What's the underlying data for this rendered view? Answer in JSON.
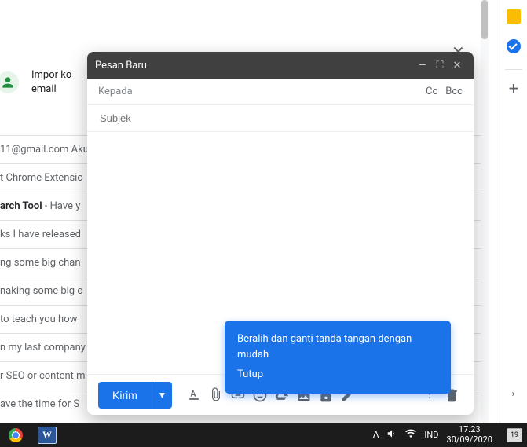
{
  "promo_line1": "Impor ko",
  "promo_line2": "email",
  "rows": [
    {
      "prefix": "",
      "bold": "",
      "suffix": "11@gmail.com Aku"
    },
    {
      "prefix": "",
      "bold": "",
      "suffix": "t Chrome Extensio"
    },
    {
      "prefix": "",
      "bold": "arch Tool",
      "suffix": " - Have y"
    },
    {
      "prefix": "",
      "bold": "",
      "suffix": "ks I have released"
    },
    {
      "prefix": "",
      "bold": "",
      "suffix": "ng some big chan"
    },
    {
      "prefix": "",
      "bold": "",
      "suffix": "naking some big c"
    },
    {
      "prefix": "",
      "bold": "",
      "suffix": " to teach you how"
    },
    {
      "prefix": "",
      "bold": "",
      "suffix": "n my last company"
    },
    {
      "prefix": "",
      "bold": "",
      "suffix": "r SEO or content m"
    },
    {
      "prefix": "",
      "bold": "",
      "suffix": "ave the time for S"
    }
  ],
  "compose": {
    "title": "Pesan Baru",
    "to_label": "Kepada",
    "cc": "Cc",
    "bcc": "Bcc",
    "subject_placeholder": "Subjek",
    "send_label": "Kirim"
  },
  "tooltip": {
    "line1": "Beralih dan ganti tanda tangan dengan mudah",
    "close": "Tutup"
  },
  "taskbar": {
    "word_glyph": "W",
    "lang": "IND",
    "time": "17.23",
    "date": "30/09/2020",
    "notif_count": "19",
    "tray_up": "ᐱ"
  },
  "glyphs": {
    "minimize": "—",
    "maximize": "⛶",
    "close": "✕",
    "chevron_down": "▾",
    "chevron_right": "›",
    "plus": "+",
    "more": "⋮",
    "big_x": "✕"
  }
}
